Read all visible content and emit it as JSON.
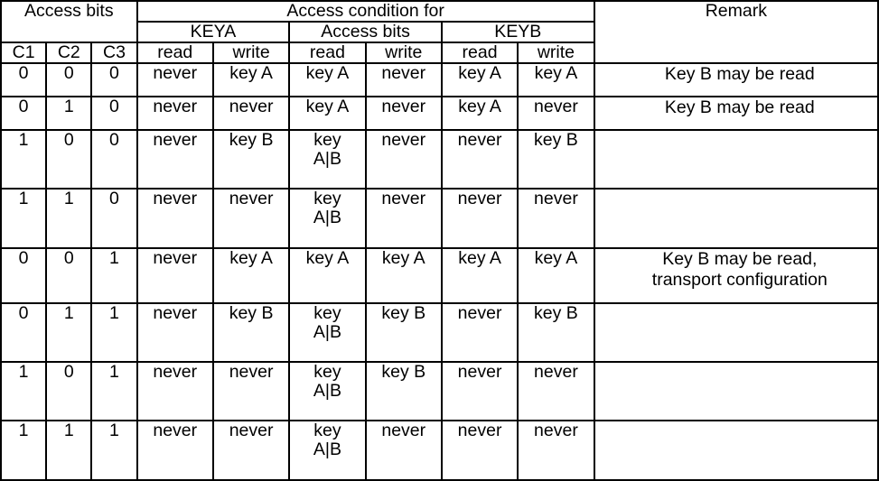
{
  "table": {
    "header": {
      "access_bits_group": "Access bits",
      "access_condition_group": "Access condition for",
      "remark_group": "Remark",
      "subgroups": {
        "keya": "KEYA",
        "access_bits": "Access bits",
        "keyb": "KEYB"
      },
      "columns": {
        "c1": "C1",
        "c2": "C2",
        "c3": "C3",
        "keya_read": "read",
        "keya_write": "write",
        "ab_read": "read",
        "ab_write": "write",
        "keyb_read": "read",
        "keyb_write": "write"
      }
    },
    "rows": [
      {
        "c1": "0",
        "c2": "0",
        "c3": "0",
        "keya_read": "never",
        "keya_write": "key A",
        "ab_read": "key A",
        "ab_write": "never",
        "keyb_read": "key A",
        "keyb_write": "key A",
        "remark_line1": "Key B may be read",
        "remark_line2": "",
        "shaded": true,
        "tall": false
      },
      {
        "c1": "0",
        "c2": "1",
        "c3": "0",
        "keya_read": "never",
        "keya_write": "never",
        "ab_read": "key A",
        "ab_write": "never",
        "keyb_read": "key A",
        "keyb_write": "never",
        "remark_line1": "Key B may be read",
        "remark_line2": "",
        "shaded": true,
        "tall": false
      },
      {
        "c1": "1",
        "c2": "0",
        "c3": "0",
        "keya_read": "never",
        "keya_write": "key B",
        "ab_read": "key A|B",
        "ab_write": "never",
        "keyb_read": "never",
        "keyb_write": "key B",
        "remark_line1": "",
        "remark_line2": "",
        "shaded": false,
        "tall": true
      },
      {
        "c1": "1",
        "c2": "1",
        "c3": "0",
        "keya_read": "never",
        "keya_write": "never",
        "ab_read": "key A|B",
        "ab_write": "never",
        "keyb_read": "never",
        "keyb_write": "never",
        "remark_line1": "",
        "remark_line2": "",
        "shaded": false,
        "tall": true
      },
      {
        "c1": "0",
        "c2": "0",
        "c3": "1",
        "keya_read": "never",
        "keya_write": "key A",
        "ab_read": "key A",
        "ab_write": "key A",
        "keyb_read": "key A",
        "keyb_write": "key A",
        "remark_line1": "Key B may be read,",
        "remark_line2": "transport configuration",
        "shaded": true,
        "tall": false
      },
      {
        "c1": "0",
        "c2": "1",
        "c3": "1",
        "keya_read": "never",
        "keya_write": "key B",
        "ab_read": "key A|B",
        "ab_write": "key B",
        "keyb_read": "never",
        "keyb_write": "key B",
        "remark_line1": "",
        "remark_line2": "",
        "shaded": false,
        "tall": true
      },
      {
        "c1": "1",
        "c2": "0",
        "c3": "1",
        "keya_read": "never",
        "keya_write": "never",
        "ab_read": "key A|B",
        "ab_write": "key B",
        "keyb_read": "never",
        "keyb_write": "never",
        "remark_line1": "",
        "remark_line2": "",
        "shaded": false,
        "tall": true
      },
      {
        "c1": "1",
        "c2": "1",
        "c3": "1",
        "keya_read": "never",
        "keya_write": "never",
        "ab_read": "key A|B",
        "ab_write": "never",
        "keyb_read": "never",
        "keyb_write": "never",
        "remark_line1": "",
        "remark_line2": "",
        "shaded": false,
        "tall": true
      }
    ]
  },
  "colors": {
    "border": "#000000",
    "shaded_row": "#e3e3e3",
    "background": "#ffffff",
    "text": "#000000"
  }
}
